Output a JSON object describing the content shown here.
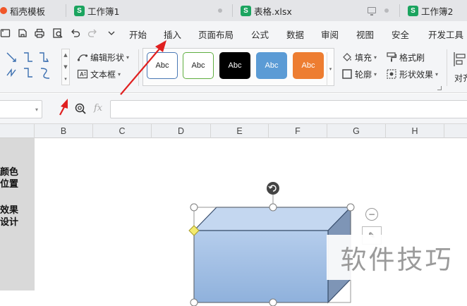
{
  "tabs": [
    {
      "label": "稻壳模板",
      "icon": "docer-icon"
    },
    {
      "label": "工作簿1",
      "icon": "spreadsheet-icon",
      "icon_letter": "S"
    },
    {
      "label": "表格.xlsx",
      "icon": "spreadsheet-icon",
      "icon_letter": "S"
    },
    {
      "label": "工作簿2",
      "icon": "spreadsheet-icon",
      "icon_letter": "S"
    }
  ],
  "quick_access": [
    "open-icon",
    "save-icon",
    "print-icon",
    "print-preview-icon",
    "undo-icon",
    "redo-icon",
    "more-icon"
  ],
  "menu": [
    "开始",
    "插入",
    "页面布局",
    "公式",
    "数据",
    "审阅",
    "视图",
    "安全",
    "开发工具"
  ],
  "ribbon": {
    "edit_shape": "编辑形状",
    "text_box": "文本框",
    "styles": [
      {
        "label": "Abc",
        "bg": "#ffffff",
        "border": "#4a78b5",
        "fg": "#222222"
      },
      {
        "label": "Abc",
        "bg": "#ffffff",
        "border": "#5fae3f",
        "fg": "#222222"
      },
      {
        "label": "Abc",
        "bg": "#000000",
        "border": "#000000",
        "fg": "#ffffff"
      },
      {
        "label": "Abc",
        "bg": "#5b9bd5",
        "border": "#5b9bd5",
        "fg": "#ffffff"
      },
      {
        "label": "Abc",
        "bg": "#ed7d31",
        "border": "#ed7d31",
        "fg": "#ffffff"
      }
    ],
    "fill": "填充",
    "outline": "轮廓",
    "format_painter": "格式刷",
    "shape_effects": "形状效果",
    "align": "对齐"
  },
  "formula_bar": {
    "fx": "fx",
    "value": ""
  },
  "columns": [
    "B",
    "C",
    "D",
    "E",
    "F",
    "G",
    "H"
  ],
  "side_panel_text": [
    "颜色",
    "位置",
    "效果",
    "设计"
  ],
  "watermark": "软件技巧",
  "colors": {
    "accent_arrow": "#e02020",
    "shape_front": "#9dbde6",
    "shape_top": "#c4d7f0",
    "shape_side": "#7e95b6",
    "shape_outline": "#3a4f6e"
  }
}
